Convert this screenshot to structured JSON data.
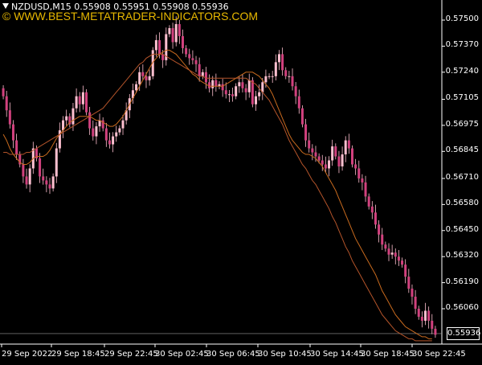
{
  "header": {
    "info": "NZDUSD,M15  0.55908 0.55951 0.55908 0.55936",
    "watermark": "© WWW.BEST-METATRADER-INDICATORS.COM"
  },
  "price_axis": [
    "0.57500",
    "0.57370",
    "0.57240",
    "0.57105",
    "0.56975",
    "0.56845",
    "0.56710",
    "0.56580",
    "0.56450",
    "0.56320",
    "0.56190",
    "0.56060"
  ],
  "time_axis": [
    "29 Sep 2022",
    "29 Sep 18:45",
    "29 Sep 22:45",
    "30 Sep 02:45",
    "30 Sep 06:45",
    "30 Sep 10:45",
    "30 Sep 14:45",
    "30 Sep 18:45",
    "30 Sep 22:45"
  ],
  "current_price": "0.55936",
  "colors": {
    "background": "#000000",
    "candle": "#d2417e",
    "candle_up": "#ffc0d0",
    "ma_fast": "#c86a1e",
    "ma_slow": "#b4542a",
    "axis": "#ffffff"
  },
  "chart_data": {
    "type": "candlestick",
    "symbol": "NZDUSD",
    "timeframe": "M15",
    "ylim": [
      0.559,
      0.576
    ],
    "closes": [
      0.5712,
      0.5705,
      0.5698,
      0.569,
      0.5683,
      0.5678,
      0.5672,
      0.5668,
      0.5676,
      0.5686,
      0.5681,
      0.5672,
      0.567,
      0.5668,
      0.5666,
      0.5672,
      0.5686,
      0.5695,
      0.57,
      0.5702,
      0.5698,
      0.5706,
      0.5712,
      0.5708,
      0.5714,
      0.5704,
      0.5696,
      0.5692,
      0.5697,
      0.57,
      0.5696,
      0.569,
      0.5688,
      0.5692,
      0.5694,
      0.5696,
      0.57,
      0.5705,
      0.5711,
      0.5715,
      0.5718,
      0.5724,
      0.5722,
      0.572,
      0.5722,
      0.5735,
      0.574,
      0.5733,
      0.573,
      0.5743,
      0.5746,
      0.5739,
      0.5748,
      0.5742,
      0.5736,
      0.5733,
      0.5731,
      0.573,
      0.5728,
      0.5722,
      0.5724,
      0.5719,
      0.5716,
      0.572,
      0.5717,
      0.5718,
      0.5715,
      0.5713,
      0.5713,
      0.5712,
      0.5717,
      0.5719,
      0.5716,
      0.5714,
      0.572,
      0.5708,
      0.5712,
      0.5714,
      0.5719,
      0.5722,
      0.5722,
      0.5722,
      0.5729,
      0.5733,
      0.5725,
      0.5722,
      0.5722,
      0.5717,
      0.5712,
      0.5706,
      0.5698,
      0.569,
      0.5686,
      0.5684,
      0.5682,
      0.568,
      0.5678,
      0.5676,
      0.568,
      0.5687,
      0.5682,
      0.5677,
      0.5683,
      0.569,
      0.5686,
      0.5678,
      0.5676,
      0.5671,
      0.5669,
      0.5662,
      0.5657,
      0.5654,
      0.5648,
      0.5643,
      0.5638,
      0.5636,
      0.5633,
      0.5634,
      0.5632,
      0.563,
      0.5628,
      0.5622,
      0.5616,
      0.5612,
      0.5606,
      0.5602,
      0.56,
      0.5605,
      0.56,
      0.5596,
      0.5593
    ],
    "ma_fast": [
      0.5693,
      0.569,
      0.5686,
      0.5683,
      0.5681,
      0.5679,
      0.5678,
      0.5678,
      0.5679,
      0.5681,
      0.5682,
      0.5682,
      0.5682,
      0.5683,
      0.5685,
      0.5688,
      0.5691,
      0.5693,
      0.5695,
      0.5697,
      0.5699,
      0.57,
      0.5701,
      0.5702,
      0.5702,
      0.5702,
      0.5702,
      0.5701,
      0.57,
      0.57,
      0.5699,
      0.5698,
      0.5697,
      0.5697,
      0.5698,
      0.57,
      0.5702,
      0.5705,
      0.5708,
      0.5711,
      0.5714,
      0.5717,
      0.572,
      0.5723,
      0.5726,
      0.5729,
      0.5731,
      0.5733,
      0.5734,
      0.5735,
      0.5735,
      0.5734,
      0.5733,
      0.5731,
      0.5729,
      0.5727,
      0.5725,
      0.5723,
      0.5722,
      0.572,
      0.5719,
      0.5718,
      0.5717,
      0.5717,
      0.5717,
      0.5717,
      0.5717,
      0.5718,
      0.5719,
      0.572,
      0.5721,
      0.5722,
      0.5723,
      0.5724,
      0.5724,
      0.5724,
      0.5723,
      0.5722,
      0.572,
      0.5718,
      0.5716,
      0.5713,
      0.5709,
      0.5705,
      0.5701,
      0.5697,
      0.5693,
      0.569,
      0.5688,
      0.5686,
      0.5684,
      0.5683,
      0.5683,
      0.5682,
      0.5681,
      0.5679,
      0.5677,
      0.5674,
      0.5671,
      0.5668,
      0.5665,
      0.5661,
      0.5657,
      0.5653,
      0.5649,
      0.5645,
      0.5641,
      0.5638,
      0.5635,
      0.5632,
      0.5629,
      0.5626,
      0.5623,
      0.5619,
      0.5615,
      0.5612,
      0.5609,
      0.5606,
      0.5603,
      0.5601,
      0.5599,
      0.5597,
      0.5596,
      0.5595,
      0.5594,
      0.5593,
      0.5592,
      0.5592,
      0.5591,
      0.5591
    ],
    "ma_slow": [
      0.5684,
      0.5684,
      0.5683,
      0.5683,
      0.5683,
      0.5683,
      0.5683,
      0.5684,
      0.5684,
      0.5685,
      0.5686,
      0.5687,
      0.5688,
      0.5689,
      0.569,
      0.5691,
      0.5692,
      0.5693,
      0.5694,
      0.5695,
      0.5696,
      0.5697,
      0.5698,
      0.5699,
      0.57,
      0.5701,
      0.5702,
      0.5703,
      0.5704,
      0.5705,
      0.5706,
      0.5708,
      0.571,
      0.5712,
      0.5714,
      0.5716,
      0.5718,
      0.572,
      0.5722,
      0.5724,
      0.5726,
      0.5728,
      0.5729,
      0.5731,
      0.5732,
      0.5733,
      0.5733,
      0.5733,
      0.5733,
      0.5732,
      0.5731,
      0.573,
      0.5729,
      0.5728,
      0.5727,
      0.5726,
      0.5725,
      0.5724,
      0.5723,
      0.5722,
      0.5722,
      0.5721,
      0.5721,
      0.5721,
      0.5721,
      0.5721,
      0.5721,
      0.5721,
      0.5721,
      0.5721,
      0.5721,
      0.5721,
      0.5721,
      0.5721,
      0.572,
      0.5719,
      0.5718,
      0.5716,
      0.5714,
      0.5712,
      0.571,
      0.5707,
      0.5704,
      0.5701,
      0.5698,
      0.5694,
      0.569,
      0.5687,
      0.5684,
      0.5681,
      0.5678,
      0.5676,
      0.5673,
      0.567,
      0.5668,
      0.5665,
      0.5662,
      0.5659,
      0.5656,
      0.5652,
      0.5649,
      0.5645,
      0.5641,
      0.5637,
      0.5634,
      0.563,
      0.5627,
      0.5624,
      0.5621,
      0.5618,
      0.5615,
      0.5612,
      0.5609,
      0.5606,
      0.5603,
      0.5601,
      0.5599,
      0.5597,
      0.5595,
      0.5594,
      0.5593,
      0.5592,
      0.5591,
      0.5591,
      0.559,
      0.559,
      0.559,
      0.559,
      0.559,
      0.559
    ]
  }
}
